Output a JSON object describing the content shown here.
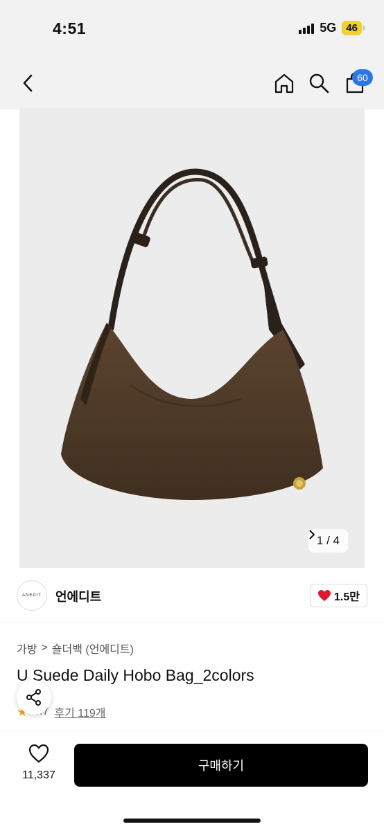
{
  "status_bar": {
    "time": "4:51",
    "network": "5G",
    "battery": "46"
  },
  "header": {
    "cart_count": "60"
  },
  "icons": {
    "back": "chevron-left-icon",
    "home": "home-icon",
    "search": "search-icon",
    "cart": "shopping-bag-icon",
    "share": "share-icon",
    "heart": "heart-icon",
    "star": "star-icon"
  },
  "gallery": {
    "counter": "1 / 4"
  },
  "brand": {
    "logo_text": "ANEDIT",
    "name": "언에디트",
    "likes": "1.5만"
  },
  "breadcrumb": {
    "category": "가방",
    "separator": ">",
    "subcategory": "숄더백 (언에디트)"
  },
  "product": {
    "title": "U Suede Daily Hobo Bag_2colors",
    "rating": "4.7",
    "reviews": "후기 119개"
  },
  "bottom_bar": {
    "wish_count": "11,337",
    "buy_label": "구매하기"
  },
  "colors": {
    "accent": "#2b78e4",
    "heart": "#e0182d",
    "buy_button": "#000000",
    "bag": "#4e3a28"
  }
}
